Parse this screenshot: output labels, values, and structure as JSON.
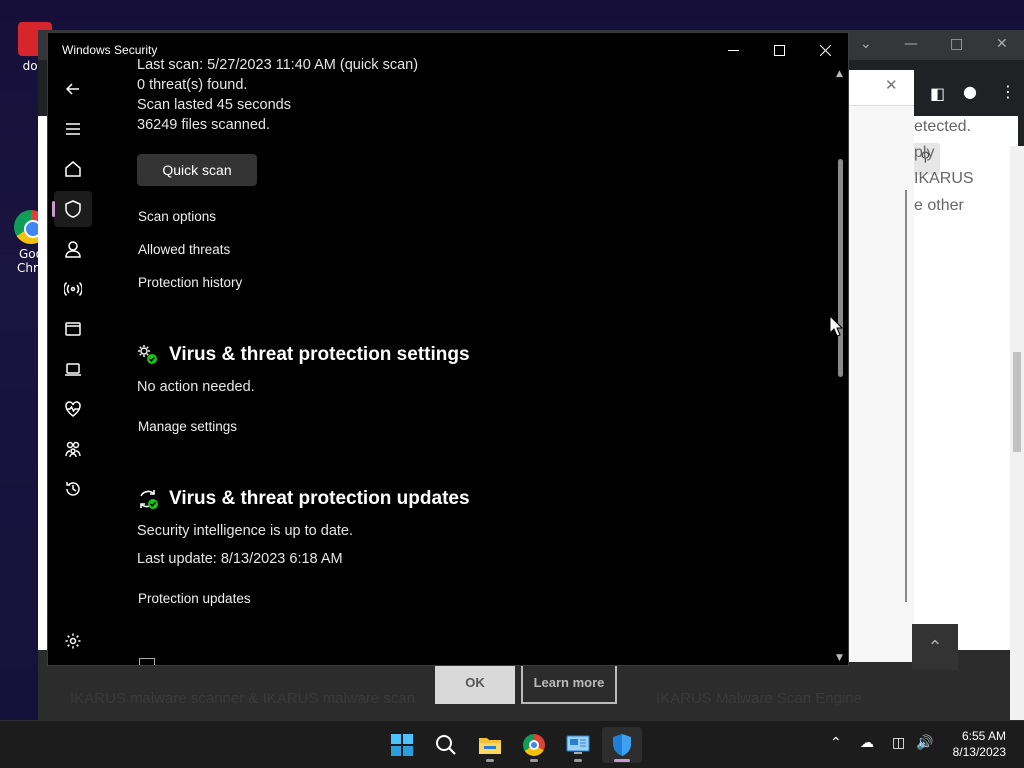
{
  "desktop": {
    "icons": [
      {
        "label": "dow"
      },
      {
        "label": "Goo\nChro"
      }
    ]
  },
  "browser": {
    "page_text": [
      "etected.",
      "ply",
      "IKARUS",
      "e other"
    ],
    "footer_links": [
      "IKARUS malware scanner & IKARUS malware scan",
      "IKARUS Malware Scan Engine"
    ],
    "ok_label": "OK",
    "learn_more_label": "Learn more"
  },
  "window": {
    "title": "Windows Security"
  },
  "last_scan": {
    "partial_line": "Last scan: 5/27/2023 11:40 AM (quick scan)",
    "threats": "0 threat(s) found.",
    "duration": "Scan lasted 45 seconds",
    "files": "36249 files scanned."
  },
  "quick_scan_label": "Quick scan",
  "links": {
    "scan_options": "Scan options",
    "allowed_threats": "Allowed threats",
    "protection_history": "Protection history"
  },
  "settings_section": {
    "title": "Virus & threat protection settings",
    "status": "No action needed.",
    "link": "Manage settings"
  },
  "updates_section": {
    "title": "Virus & threat protection updates",
    "status": "Security intelligence is up to date.",
    "last_update": "Last update: 8/13/2023 6:18 AM",
    "link": "Protection updates"
  },
  "taskbar": {
    "time": "6:55 AM",
    "date": "8/13/2023"
  },
  "colors": {
    "accent": "#c89bd4",
    "window_bg": "#000000",
    "status_ok": "#16c60c"
  }
}
